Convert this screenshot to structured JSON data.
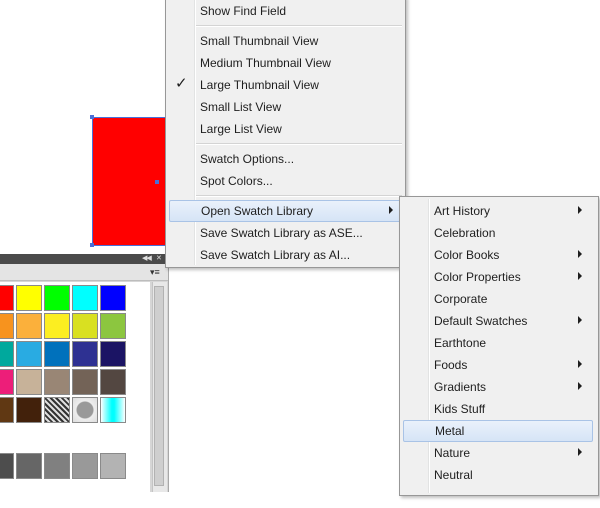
{
  "menu": {
    "items": [
      {
        "label": "Show Find Field"
      },
      {
        "label": "Small Thumbnail View"
      },
      {
        "label": "Medium Thumbnail View"
      },
      {
        "label": "Large Thumbnail View",
        "checked": true
      },
      {
        "label": "Small List View"
      },
      {
        "label": "Large List View"
      },
      {
        "label": "Swatch Options..."
      },
      {
        "label": "Spot Colors..."
      },
      {
        "label": "Open Swatch Library",
        "submenu": true,
        "highlighted": true
      },
      {
        "label": "Save Swatch Library as ASE..."
      },
      {
        "label": "Save Swatch Library as AI..."
      }
    ]
  },
  "submenu": {
    "items": [
      {
        "label": "Art History",
        "submenu": true
      },
      {
        "label": "Celebration"
      },
      {
        "label": "Color Books",
        "submenu": true
      },
      {
        "label": "Color Properties",
        "submenu": true
      },
      {
        "label": "Corporate"
      },
      {
        "label": "Default Swatches",
        "submenu": true
      },
      {
        "label": "Earthtone"
      },
      {
        "label": "Foods",
        "submenu": true
      },
      {
        "label": "Gradients",
        "submenu": true
      },
      {
        "label": "Kids Stuff"
      },
      {
        "label": "Metal",
        "highlighted": true
      },
      {
        "label": "Nature",
        "submenu": true
      },
      {
        "label": "Neutral"
      },
      {
        "label": ""
      }
    ]
  },
  "icons": {
    "check": "checkmark-icon",
    "submenu_arrow": "chevron-right-icon",
    "panel_menu": "panel-menu-icon",
    "collapse": "collapse-icon"
  },
  "canvas": {
    "object_color": "#ff0000",
    "selection_color": "#4a6fd8"
  },
  "swatches": {
    "rows": [
      [
        "#ff0000",
        "#ffff00",
        "#00ff00",
        "#00ffff",
        "#0000ff"
      ],
      [
        "#f7931e",
        "#fbb03b",
        "#fcee21",
        "#d9e021",
        "#8cc63f"
      ],
      [
        "#00a99d",
        "#29abe2",
        "#0071bc",
        "#2e3192",
        "#1b1464"
      ],
      [
        "#ed1e79",
        "#c7b299",
        "#998675",
        "#736357",
        "#534741"
      ],
      [
        "#603813",
        "#42210b",
        "pattern-dots",
        "pattern-radial",
        "pattern-cyan"
      ],
      [
        "#4d4d4d",
        "#666666",
        "#808080",
        "#999999",
        "#b3b3b3"
      ]
    ]
  }
}
